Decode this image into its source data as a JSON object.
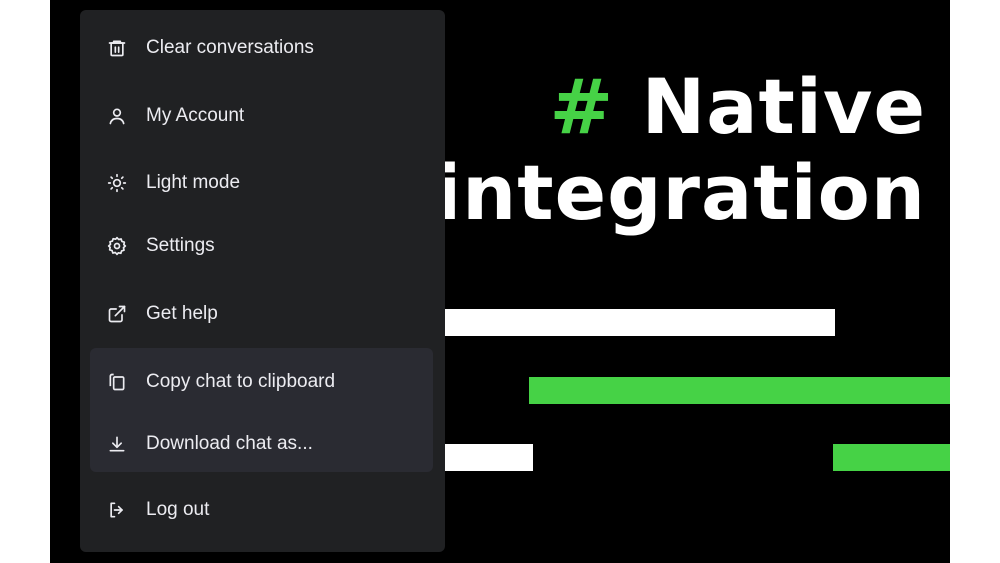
{
  "menu": {
    "items": [
      {
        "label": "Clear conversations",
        "icon": "trash-icon"
      },
      {
        "label": "My Account",
        "icon": "user-icon"
      },
      {
        "label": "Light mode",
        "icon": "sun-icon"
      },
      {
        "label": "Settings",
        "icon": "gear-icon"
      },
      {
        "label": "Get help",
        "icon": "external-link-icon"
      },
      {
        "label": "Copy chat to clipboard",
        "icon": "copy-icon"
      },
      {
        "label": "Download chat as...",
        "icon": "download-icon"
      },
      {
        "label": "Log out",
        "icon": "logout-icon"
      }
    ]
  },
  "background": {
    "headline_hash": "#",
    "headline_line1": "Native",
    "headline_line2": "integration",
    "colors": {
      "accent": "#46d246",
      "bar_white": "#ffffff",
      "background": "#000000",
      "menu": "#202123",
      "menu_group": "#2a2b32"
    }
  }
}
